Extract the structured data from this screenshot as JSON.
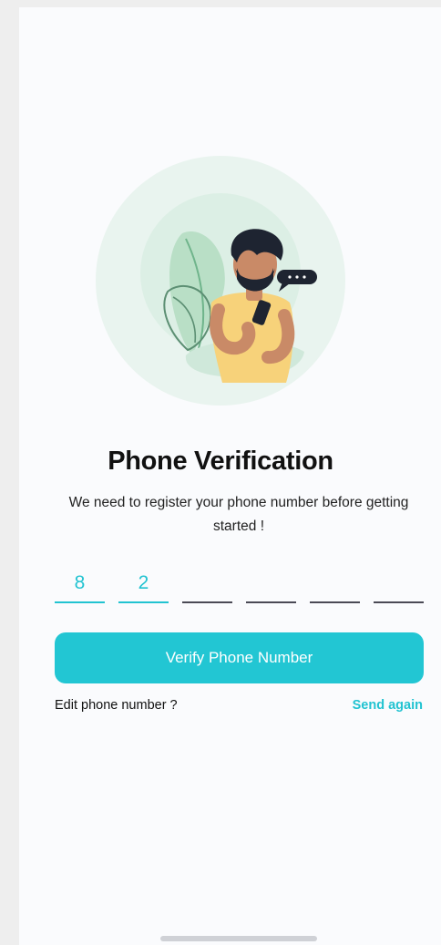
{
  "screen": {
    "title": "Phone Verification",
    "subtitle": "We need to register your phone number before getting started !"
  },
  "otp": {
    "digits": [
      "8",
      "2",
      "",
      "",
      "",
      ""
    ]
  },
  "actions": {
    "verify_label": "Verify Phone Number",
    "edit_label": "Edit phone number ?",
    "send_again_label": "Send again"
  },
  "colors": {
    "accent": "#22c6d3",
    "background": "#fafbfd",
    "text": "#111111"
  }
}
